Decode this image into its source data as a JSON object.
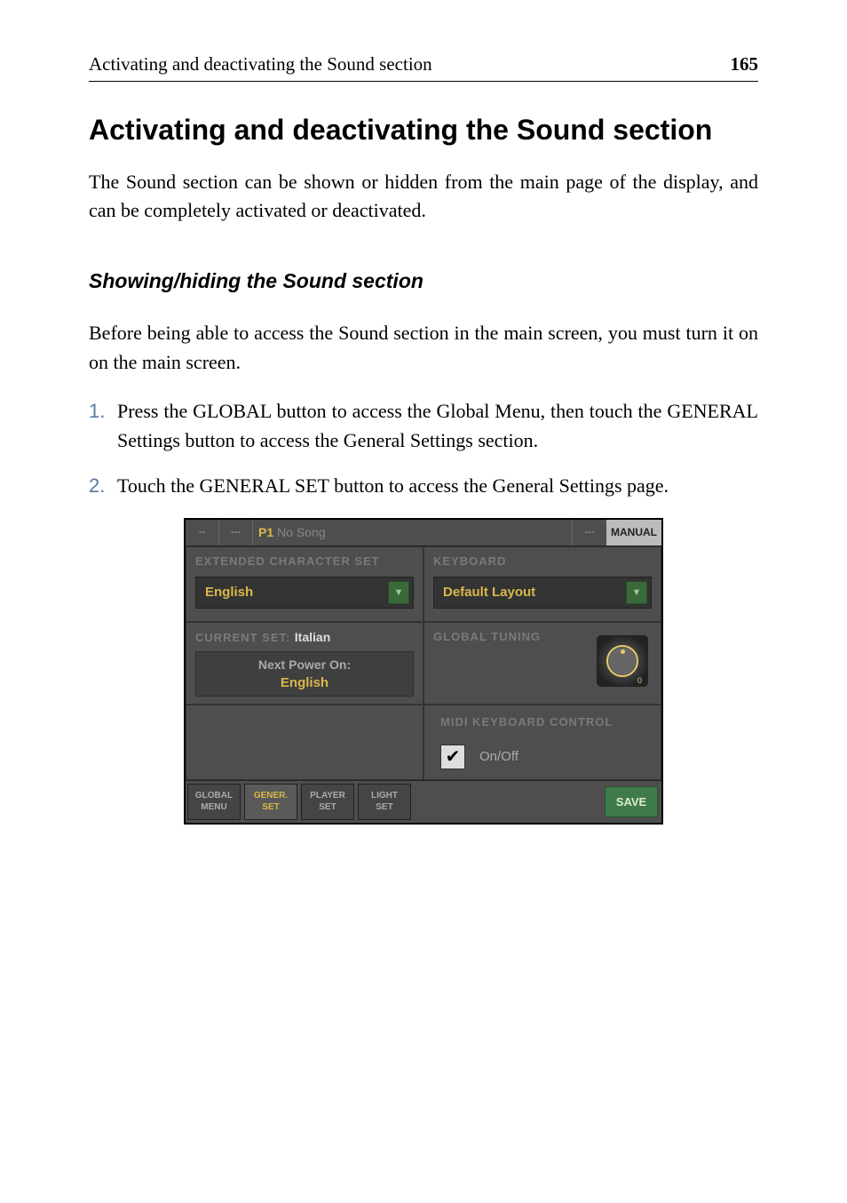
{
  "header": {
    "left": "Activating and deactivating the Sound section",
    "right": "165"
  },
  "title": "Activating and deactivating the Sound section",
  "intro": "The Sound section can be shown or hidden from the main page of the display, and can be completely activated or deactivated.",
  "subsection": "Showing/hiding the Sound section",
  "before": "Before being able to access the Sound section in the main screen, you must turn it on on the main screen.",
  "steps": [
    {
      "num": "1.",
      "text": "Press the GLOBAL button to access the Global Menu, then touch the GENERAL Settings button to access the General Settings section."
    },
    {
      "num": "2.",
      "text": "Touch the GENERAL SET button to access the General Settings page."
    }
  ],
  "screenshot": {
    "topbar": {
      "cell1": "--",
      "cell2": "---",
      "p1": "P1",
      "nosong": "No Song",
      "cell4": "---",
      "manual": "MANUAL"
    },
    "panels": {
      "extended": {
        "header": "EXTENDED CHARACTER SET",
        "value": "English"
      },
      "keyboard": {
        "header": "KEYBOARD",
        "value": "Default Layout"
      },
      "currentset": {
        "header": "CURRENT SET:",
        "value": "Italian",
        "nextpower_label": "Next Power On:",
        "nextpower_value": "English"
      },
      "tuning": {
        "header": "GLOBAL TUNING",
        "zero": "0"
      },
      "midi": {
        "header": "MIDI KEYBOARD CONTROL",
        "label": "On/Off"
      }
    },
    "bottom": {
      "btn1_l1": "GLOBAL",
      "btn1_l2": "MENU",
      "btn2_l1": "GENER.",
      "btn2_l2": "SET",
      "btn3_l1": "PLAYER",
      "btn3_l2": "SET",
      "btn4_l1": "LIGHT",
      "btn4_l2": "SET",
      "save": "SAVE"
    }
  }
}
